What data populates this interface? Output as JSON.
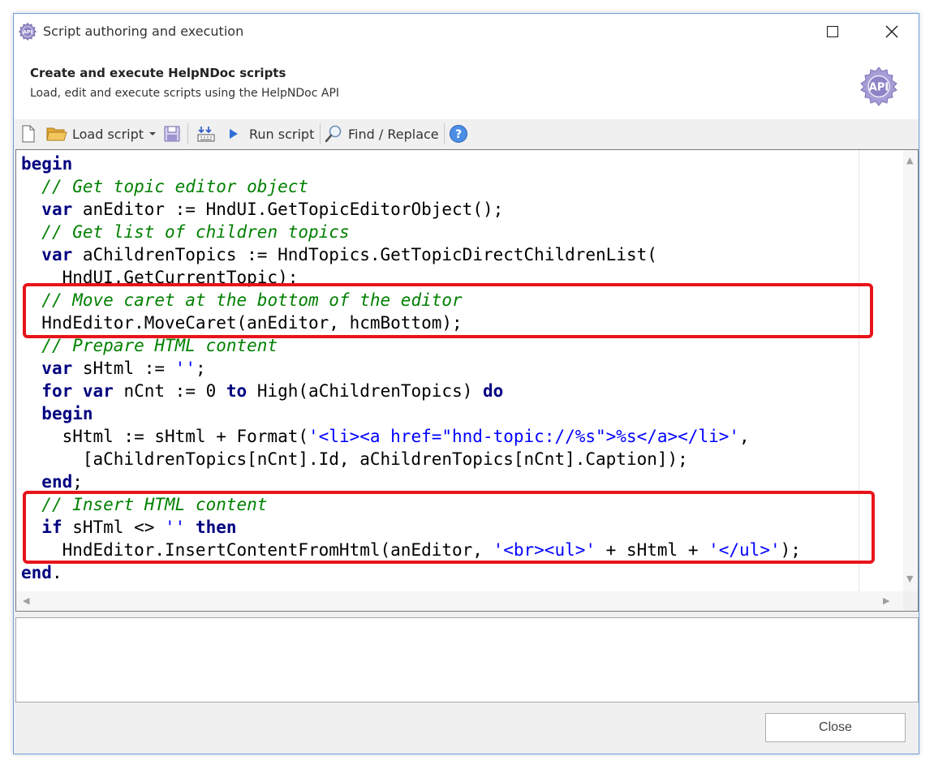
{
  "window": {
    "title": "Script authoring and execution",
    "maximize_icon": "maximize-icon",
    "close_icon": "close-icon"
  },
  "header": {
    "title": "Create and execute HelpNDoc scripts",
    "subtitle": "Load, edit and execute scripts using the HelpNDoc API",
    "logo_text": "API"
  },
  "toolbar": {
    "load_label": "Load script",
    "run_label": "Run script",
    "find_label": "Find / Replace",
    "icons": [
      "new-file-icon",
      "folder-open-icon",
      "dropdown-arrow-icon",
      "save-icon",
      "compile-icon",
      "run-icon",
      "search-icon",
      "help-icon"
    ]
  },
  "code_lines": [
    [
      [
        "kw",
        "begin"
      ]
    ],
    [
      [
        "",
        "  "
      ],
      [
        "cm",
        "// Get topic editor object"
      ]
    ],
    [
      [
        "",
        "  "
      ],
      [
        "kw",
        "var"
      ],
      [
        "",
        " anEditor := HndUI.GetTopicEditorObject();"
      ]
    ],
    [
      [
        "",
        "  "
      ],
      [
        "cm",
        "// Get list of children topics"
      ]
    ],
    [
      [
        "",
        "  "
      ],
      [
        "kw",
        "var"
      ],
      [
        "",
        " aChildrenTopics := HndTopics.GetTopicDirectChildrenList("
      ]
    ],
    [
      [
        "",
        "    HndUI.GetCurrentTopic);"
      ]
    ],
    [
      [
        "",
        "  "
      ],
      [
        "cm",
        "// Move caret at the bottom of the editor"
      ]
    ],
    [
      [
        "",
        "  HndEditor.MoveCaret(anEditor, hcmBottom);"
      ]
    ],
    [
      [
        "",
        "  "
      ],
      [
        "cm",
        "// Prepare HTML content"
      ]
    ],
    [
      [
        "",
        "  "
      ],
      [
        "kw",
        "var"
      ],
      [
        "",
        " sHtml := "
      ],
      [
        "st",
        "''"
      ],
      [
        "",
        ";"
      ]
    ],
    [
      [
        "",
        "  "
      ],
      [
        "kw",
        "for"
      ],
      [
        "",
        " "
      ],
      [
        "kw",
        "var"
      ],
      [
        "",
        " nCnt := 0 "
      ],
      [
        "kw",
        "to"
      ],
      [
        "",
        " High(aChildrenTopics) "
      ],
      [
        "kw",
        "do"
      ]
    ],
    [
      [
        "",
        "  "
      ],
      [
        "kw",
        "begin"
      ]
    ],
    [
      [
        "",
        "    sHtml := sHtml + Format("
      ],
      [
        "st",
        "'<li><a href=\"hnd-topic://%s\">%s</a></li>'"
      ],
      [
        "",
        ","
      ]
    ],
    [
      [
        "",
        "      [aChildrenTopics[nCnt].Id, aChildrenTopics[nCnt].Caption]);"
      ]
    ],
    [
      [
        "",
        "  "
      ],
      [
        "kw",
        "end"
      ],
      [
        "",
        ";"
      ]
    ],
    [
      [
        "",
        "  "
      ],
      [
        "cm",
        "// Insert HTML content"
      ]
    ],
    [
      [
        "",
        "  "
      ],
      [
        "kw",
        "if"
      ],
      [
        "",
        " sHTml <> "
      ],
      [
        "st",
        "''"
      ],
      [
        "",
        " "
      ],
      [
        "kw",
        "then"
      ]
    ],
    [
      [
        "",
        "    HndEditor.InsertContentFromHtml(anEditor, "
      ],
      [
        "st",
        "'<br><ul>'"
      ],
      [
        "",
        " + sHtml + "
      ],
      [
        "st",
        "'</ul>'"
      ],
      [
        "",
        ");"
      ]
    ],
    [
      [
        "kw",
        "end"
      ],
      [
        "",
        "."
      ]
    ]
  ],
  "output_text": "",
  "footer": {
    "close_label": "Close"
  },
  "colors": {
    "keyword": "#000080",
    "comment": "#008000",
    "string": "#0000ff",
    "highlight_box": "#e8141b"
  }
}
